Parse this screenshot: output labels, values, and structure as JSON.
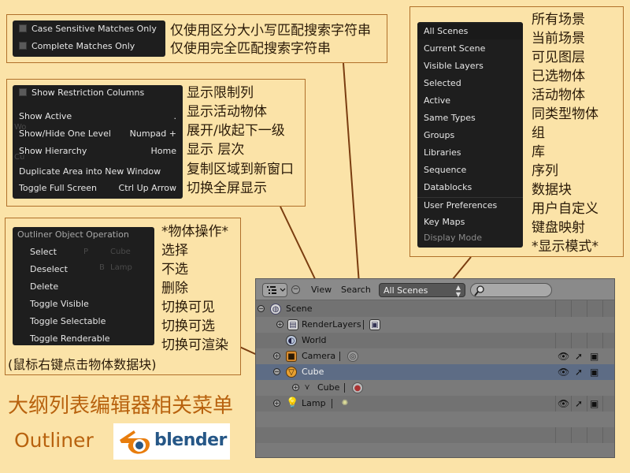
{
  "search_options": {
    "items": [
      {
        "label": "Case Sensitive Matches Only",
        "cn": "仅使用区分大小写匹配搜索字符串"
      },
      {
        "label": "Complete Matches Only",
        "cn": "仅使用完全匹配搜索字符串"
      }
    ]
  },
  "view_menu": {
    "items": [
      {
        "label": "Show Restriction Columns",
        "shortcut": "",
        "cn": "显示限制列"
      },
      {
        "label": "Show Active",
        "shortcut": ".",
        "cn": "显示活动物体"
      },
      {
        "label": "Show/Hide One Level",
        "shortcut": "Numpad +",
        "cn": "展开/收起下一级"
      },
      {
        "label": "Show Hierarchy",
        "shortcut": "Home",
        "cn": "显示 层次"
      },
      {
        "label": "Duplicate Area into New Window",
        "shortcut": "",
        "cn": "复制区域到新窗口"
      },
      {
        "label": "Toggle Full Screen",
        "shortcut": "Ctrl Up Arrow",
        "cn": "切换全屏显示"
      }
    ]
  },
  "display_mode_menu": {
    "items": [
      {
        "label": "All Scenes",
        "cn": "所有场景"
      },
      {
        "label": "Current Scene",
        "cn": "当前场景"
      },
      {
        "label": "Visible Layers",
        "cn": "可见图层"
      },
      {
        "label": "Selected",
        "cn": "已选物体"
      },
      {
        "label": "Active",
        "cn": "活动物体"
      },
      {
        "label": "Same Types",
        "cn": "同类型物体"
      },
      {
        "label": "Groups",
        "cn": "组"
      },
      {
        "label": "Libraries",
        "cn": "库"
      },
      {
        "label": "Sequence",
        "cn": "序列"
      },
      {
        "label": "Datablocks",
        "cn": "数据块"
      },
      {
        "label": "User Preferences",
        "cn": "用户自定义"
      },
      {
        "label": "Key Maps",
        "cn": "键盘映射"
      },
      {
        "label": "Display Mode",
        "cn": "*显示模式*"
      }
    ]
  },
  "object_menu": {
    "title": "Outliner Object Operation",
    "title_cn": "*物体操作*",
    "items": [
      {
        "label": "Select",
        "cn": "选择"
      },
      {
        "label": "Deselect",
        "cn": "不选"
      },
      {
        "label": "Delete",
        "cn": "删除"
      },
      {
        "label": "Toggle Visible",
        "cn": "切换可见"
      },
      {
        "label": "Toggle Selectable",
        "cn": "切换可选"
      },
      {
        "label": "Toggle Renderable",
        "cn": "切换可渲染"
      }
    ],
    "note": "(鼠标右键点击物体数据块)"
  },
  "ghost_text": {
    "p": "P",
    "bl": "B",
    "cube": "Cube",
    "lamp": "Lamp",
    "menu_bg_a": "Wo",
    "menu_bg_b": "Cu"
  },
  "header": {
    "view": "View",
    "search": "Search",
    "display_mode": "All Scenes"
  },
  "tree": {
    "rows": [
      {
        "label": "Scene",
        "icon": "scene-icon"
      },
      {
        "label": "RenderLayers",
        "icon": "renderlayers-icon"
      },
      {
        "label": "World",
        "icon": "world-icon"
      },
      {
        "label": "Camera",
        "icon": "camera-icon"
      },
      {
        "label": "Cube",
        "icon": "mesh-object-icon"
      },
      {
        "label": "Cube",
        "icon": "mesh-data-icon"
      },
      {
        "label": "Lamp",
        "icon": "lamp-icon"
      }
    ]
  },
  "footer": {
    "title": "大纲列表编辑器相关菜单",
    "subtitle": "Outliner",
    "logo_text": "blender"
  },
  "colors": {
    "background": "#fbe3a8",
    "menu": "#1e1e1e",
    "accent_title": "#b8620e",
    "blender_orange": "#e87d0d",
    "blender_blue": "#265787"
  }
}
